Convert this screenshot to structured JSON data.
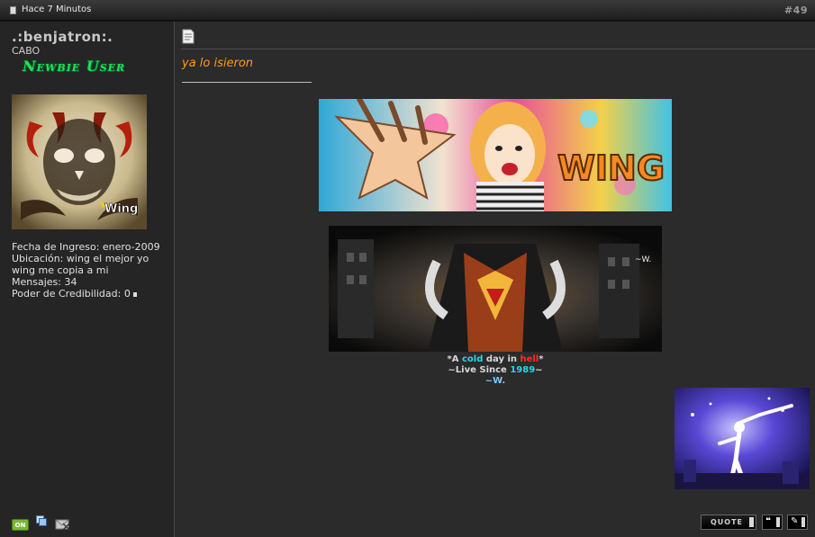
{
  "header": {
    "time_label": "Hace 7 Minutos",
    "post_number": "#49"
  },
  "user": {
    "username": ".:benjatron:.",
    "rank": "CABO",
    "rank_badge": "Newbie User",
    "avatar_caption": "Wing",
    "info": {
      "join_date": "Fecha de Ingreso: enero-2009",
      "location": "Ubicación: wing el mejor yo wing me copia a mi",
      "posts": "Mensajes: 34",
      "credibility": "Poder de Credibilidad: 0"
    },
    "online_label": "ON"
  },
  "post": {
    "message": "ya lo isieron",
    "signature": {
      "banner1_text": "WING",
      "banner2_tag": "~W.",
      "line1_parts": [
        "*A ",
        "cold",
        " day in ",
        "hell",
        "*"
      ],
      "line2_parts": [
        "~Live Since ",
        "1989",
        "~"
      ],
      "line3": "~W."
    }
  },
  "actions": {
    "quote_label": "QUOTE"
  },
  "colors": {
    "accent_orange": "#ff9a1a",
    "badge_green": "#1ee05a",
    "sig_cyan": "#28d6e6",
    "sig_red": "#ff2a2a",
    "online_green": "#7ab833"
  }
}
